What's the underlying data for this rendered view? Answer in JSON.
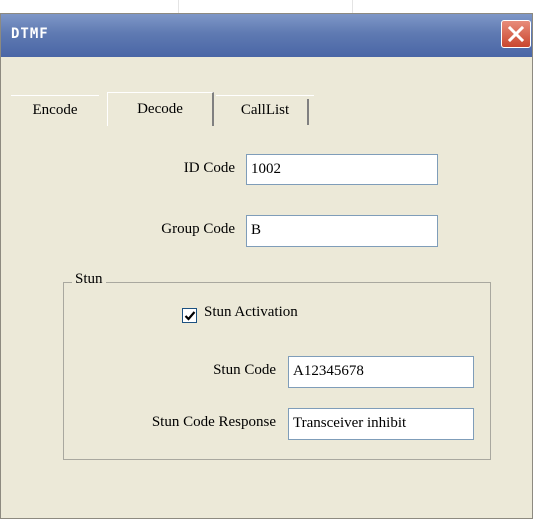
{
  "window": {
    "title": "DTMF"
  },
  "tabs": [
    {
      "label": "Encode",
      "active": false
    },
    {
      "label": "Decode",
      "active": true
    },
    {
      "label": "CallList",
      "active": false
    }
  ],
  "decode": {
    "id_code": {
      "label": "ID Code",
      "value": "1002"
    },
    "group_code": {
      "label": "Group Code",
      "value": "B"
    },
    "stun_group": {
      "title": "Stun",
      "activation": {
        "label": "Stun Activation",
        "checked": true
      },
      "stun_code": {
        "label": "Stun Code",
        "value": "A12345678"
      },
      "response": {
        "label": "Stun Code Response",
        "value": "Transceiver inhibit"
      }
    }
  },
  "colors": {
    "titlebar": "#5f7ab2",
    "dialog_bg": "#ece9d8",
    "close": "#c9462e"
  }
}
